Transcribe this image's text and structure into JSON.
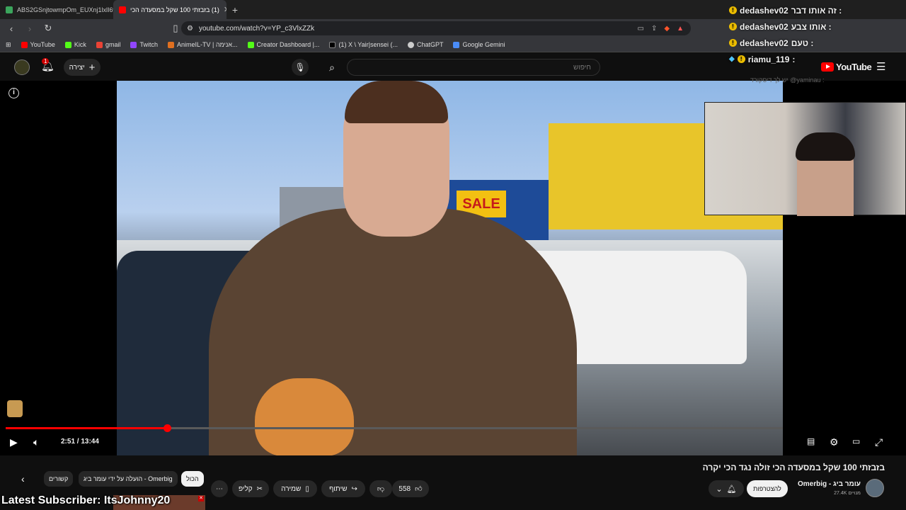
{
  "browser": {
    "tabs": [
      {
        "label": "ABS2GSnjtowmpOm_EUXnj1lxlI6wK"
      },
      {
        "label": "(1) בזבזתי 100 שקל במסעדה הכי"
      }
    ],
    "new_tab": "+",
    "url": "youtube.com/watch?v=YP_c3VlxZZk",
    "bookmarks": [
      "YouTube",
      "Kick",
      "gmail",
      "Twitch",
      "AnimeIL-TV | אנימה...",
      "Creator Dashboard |...",
      "(1) X \\ Yair|sensei (...",
      "ChatGPT",
      "Google Gemini"
    ]
  },
  "youtube": {
    "create_label": "יצירה",
    "notification_count": "1",
    "search_placeholder": "חיפוש",
    "logo_text": "YouTube"
  },
  "chat": [
    {
      "user": "dedashev02",
      "message": ": זה אותו דבר"
    },
    {
      "user": "dedashev02",
      "message": ": אותו צבע"
    },
    {
      "user": "dedashev02",
      "message": ": טעם"
    },
    {
      "user": "riamu_119",
      "message": ":"
    }
  ],
  "chat_faded": "יש לך דיסקורד @yaminau :",
  "player": {
    "current_time": "2:51",
    "duration": "13:44",
    "time_display": "2:51 / 13:44",
    "progress_fraction": 0.2075
  },
  "video": {
    "title": "בזבזתי 100 שקל במסעדה הכי זולה נגד הכי יקרה",
    "channel_name": "Omerbig - עומר ביג",
    "subscribers": "27.4K מנויים",
    "join_label": "להצטרפות",
    "likes": "558",
    "share_label": "שיתוף",
    "save_label": "שמירה",
    "clip_label": "קליפ"
  },
  "filter_chips": {
    "all": "הכול",
    "uploaded_by": "הועלה על ידי עומר ביג - Omerbig",
    "related": "קשורים"
  },
  "overlay": {
    "latest_subscriber": "Latest Subscriber: ItsJohnny20"
  },
  "scene_sign": "SALE"
}
